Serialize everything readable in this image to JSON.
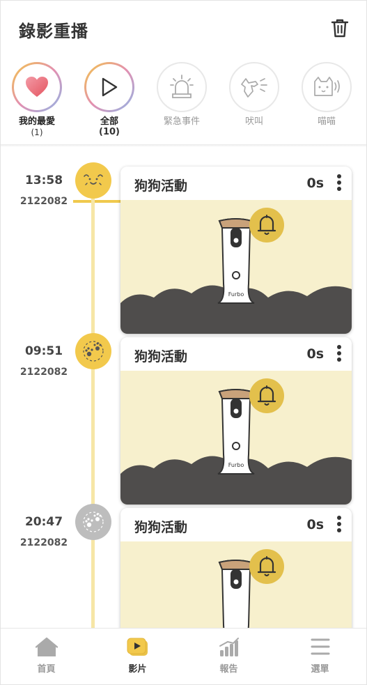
{
  "header": {
    "title": "錄影重播"
  },
  "filters": [
    {
      "label": "我的最愛",
      "count": "(1)",
      "icon": "heart-icon"
    },
    {
      "label": "全部",
      "count": "(10)",
      "icon": "play-icon",
      "active": true
    },
    {
      "label": "緊急事件",
      "count": "",
      "icon": "alarm-icon"
    },
    {
      "label": "吠叫",
      "count": "",
      "icon": "barking-dog-icon"
    },
    {
      "label": "喵喵",
      "count": "",
      "icon": "meowing-cat-icon"
    }
  ],
  "timeline": [
    {
      "time": "13:58",
      "date": "2122082",
      "title": "狗狗活動",
      "duration": "0s",
      "event_icon": "dog-face-icon",
      "thumb_brand": "Furbo"
    },
    {
      "time": "09:51",
      "date": "2122082",
      "title": "狗狗活動",
      "duration": "0s",
      "event_icon": "paw-activity-icon",
      "thumb_brand": "Furbo"
    },
    {
      "time": "20:47",
      "date": "2122082",
      "title": "狗狗活動",
      "duration": "0s",
      "event_icon": "paw-activity-icon",
      "thumb_brand": ""
    }
  ],
  "nav": [
    {
      "label": "首頁",
      "icon": "home-icon"
    },
    {
      "label": "影片",
      "icon": "video-icon",
      "active": true
    },
    {
      "label": "報告",
      "icon": "report-chart-icon"
    },
    {
      "label": "選單",
      "icon": "menu-icon"
    }
  ],
  "colors": {
    "accent": "#f2c94c",
    "timeline": "#f6e6a6",
    "thumb_bg": "#f7f0cd",
    "hills": "#4f4d4c",
    "inactive_dot": "#bdbdbd"
  }
}
